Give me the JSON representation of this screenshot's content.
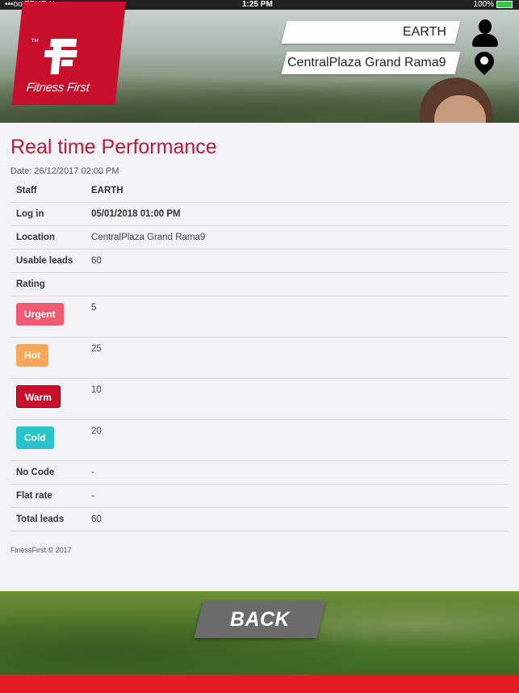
{
  "status_bar": {
    "carrier": "•••oo TRUE-H",
    "time": "1:25 PM",
    "battery": "100%"
  },
  "brand": {
    "name": "Fitness First",
    "tm": "TM",
    "color": "#c8102e"
  },
  "header": {
    "staff_name": "EARTH",
    "location": "CentralPlaza Grand Rama9"
  },
  "main": {
    "title": "Real time Performance",
    "date": "Date: 26/12/2017 02:00 PM",
    "rows": {
      "staff": {
        "label": "Staff",
        "value": "EARTH"
      },
      "login": {
        "label": "Log in",
        "value": "05/01/2018 01:00 PM"
      },
      "location": {
        "label": "Location",
        "value": "CentralPlaza Grand Rama9"
      },
      "usable_leads": {
        "label": "Usable leads",
        "value": "60"
      },
      "rating": {
        "label": "Rating"
      },
      "no_code": {
        "label": "No Code",
        "value": "-"
      },
      "flat_rate": {
        "label": "Flat rate",
        "value": "-"
      },
      "total_leads": {
        "label": "Total leads",
        "value": "60"
      }
    },
    "ratings": [
      {
        "label": "Urgent",
        "value": "5",
        "color": "#ef5b72"
      },
      {
        "label": "Hot",
        "value": "25",
        "color": "#f5a85a"
      },
      {
        "label": "Warm",
        "value": "10",
        "color": "#c8102e"
      },
      {
        "label": "Cold",
        "value": "20",
        "color": "#29c3c8"
      }
    ],
    "footer": "FinessFirst © 2017"
  },
  "actions": {
    "back_label": "BACK"
  }
}
